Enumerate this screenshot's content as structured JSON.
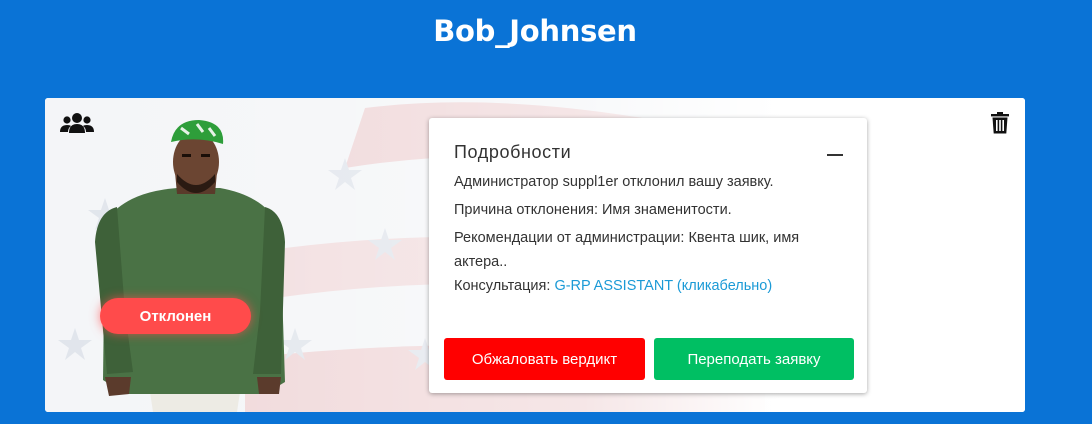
{
  "header": {
    "title": "Bob_Johnsen"
  },
  "card": {
    "status": "Отклонен",
    "details": {
      "title": "Подробности",
      "admin_line": "Администратор suppl1er отклонил вашу заявку.",
      "reason_line": "Причина отклонения: Имя знаменитости.",
      "recommend_line": "Рекомендации от администрации: Квента шик, имя актера..",
      "consult_label": "Консультация: ",
      "consult_link": "G-RP ASSISTANT (кликабельно)",
      "appeal_button": "Обжаловать вердикт",
      "resubmit_button": "Переподать заявку"
    },
    "icons": {
      "top_left": "users-group-icon",
      "top_right": "trash-icon",
      "collapse": "minus-icon"
    }
  },
  "colors": {
    "background": "#0A73D6",
    "status_badge": "#FF4B4B",
    "appeal_button": "#FF0000",
    "resubmit_button": "#00BF63",
    "link": "#1B9AD6"
  }
}
